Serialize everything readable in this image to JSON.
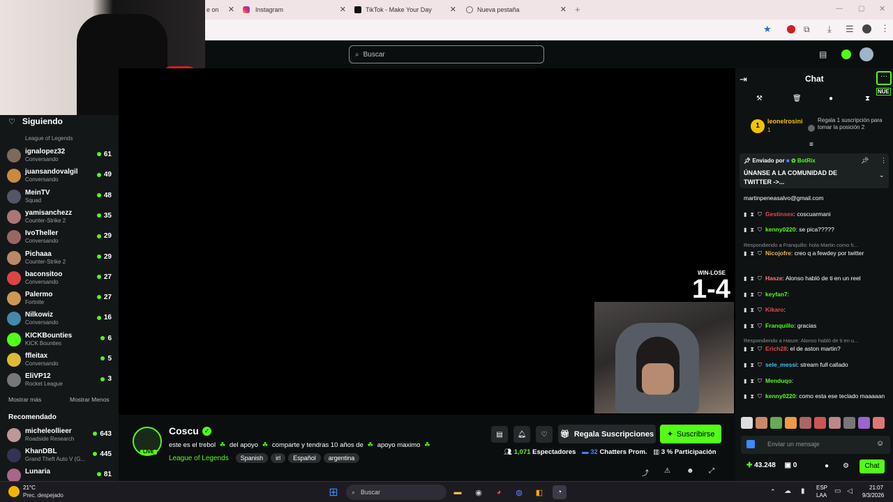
{
  "browser": {
    "tabs": [
      {
        "label": "e on"
      },
      {
        "label": "Instagram"
      },
      {
        "label": "TikTok - Make Your Day"
      },
      {
        "label": "Nueva pestaña"
      }
    ]
  },
  "header": {
    "search_placeholder": "Buscar"
  },
  "sidebar": {
    "following_title": "Siguiendo",
    "top_category": "League of Legends",
    "channels": [
      {
        "name": "ignalopez32",
        "category": "Conversando",
        "viewers": "61",
        "color": "#7d6a5a"
      },
      {
        "name": "juansandovalgil",
        "category": "Conversando",
        "viewers": "49",
        "color": "#c98a40"
      },
      {
        "name": "MeinTV",
        "category": "Squad",
        "viewers": "48",
        "color": "#556"
      },
      {
        "name": "yamisanchezz",
        "category": "Counter-Strike 2",
        "viewers": "35",
        "color": "#a77"
      },
      {
        "name": "IvoTheller",
        "category": "Conversando",
        "viewers": "29",
        "color": "#966"
      },
      {
        "name": "Pichaaa",
        "category": "Counter-Strike 2",
        "viewers": "29",
        "color": "#b86"
      },
      {
        "name": "baconsitoo",
        "category": "Conversando",
        "viewers": "27",
        "color": "#d44"
      },
      {
        "name": "Palermo",
        "category": "Fortnite",
        "viewers": "27",
        "color": "#c95"
      },
      {
        "name": "Nilkowiz",
        "category": "Conversando",
        "viewers": "16",
        "color": "#48a"
      },
      {
        "name": "KICKBounties",
        "category": "KICK Bounties",
        "viewers": "6",
        "color": "#53fc18"
      },
      {
        "name": "ffleitax",
        "category": "Conversando",
        "viewers": "5",
        "color": "#db3"
      },
      {
        "name": "EliVP12",
        "category": "Rocket League",
        "viewers": "3",
        "color": "#777"
      }
    ],
    "show_more": "Mostrar más",
    "show_less": "Mostrar Menos",
    "recommended_title": "Recomendado",
    "recommended": [
      {
        "name": "micheleollieer",
        "category": "Roadside Research",
        "viewers": "643",
        "color": "#b99"
      },
      {
        "name": "KhanDBL",
        "category": "Grand Theft Auto V (G...",
        "viewers": "445",
        "color": "#335"
      },
      {
        "name": "Lunaria",
        "category": "",
        "viewers": "81",
        "color": "#a68"
      }
    ]
  },
  "overlay": {
    "label": "WIN-LOSE",
    "score": "1-4"
  },
  "stream": {
    "streamer": "Coscu",
    "live_badge": "LIVE",
    "title_parts": [
      "este es el trebol",
      "del apoyo",
      "comparte y tendras 10 años de",
      "apoyo maximo"
    ],
    "category": "League of Legends",
    "tags": [
      "Spanish",
      "irl",
      "Español",
      "argentina"
    ],
    "gift_button": "Regala Suscripciones",
    "subscribe_button": "Suscribirse",
    "viewers": "1,071",
    "viewers_label": "Espectadores",
    "chatters": "32",
    "chatters_label": "Chatters Prom.",
    "participation": "3",
    "participation_label": "% Participación"
  },
  "chat": {
    "title": "Chat",
    "new_badge": "NUE",
    "top_gifter": {
      "rank": "1",
      "name": "leonelrosini",
      "count": "1"
    },
    "gift_prompt": "Regala 1 suscripción para tomar la posición 2",
    "pinned": {
      "sent_by": "Enviado por",
      "bot": "BotRix",
      "text": "ÚNANSE A LA COMUNIDAD DE TWITTER ->..."
    },
    "email_line": "martinpeneasalvo@gmail.com",
    "messages": [
      {
        "user": "Gestinsex",
        "text": ": coscuarmani",
        "color": "#e5484d"
      },
      {
        "user": "kenny0220",
        "text": ": se pica?????",
        "color": "#53fc18"
      },
      {
        "reply": "Respondiendo a Franquillo: hola Martin como h..."
      },
      {
        "user": "Nicojofre",
        "text": ": creo q a fewdey por twitter",
        "color": "#e8b84a"
      },
      {
        "user": "Hasze",
        "text": ": Alonso habló de ti en un reel",
        "color": "#ff7a7a"
      },
      {
        "user": "keyfan7",
        "text": ":",
        "color": "#53fc18"
      },
      {
        "user": "Kikaro",
        "text": ":",
        "color": "#e5484d"
      },
      {
        "user": "Franquillo",
        "text": ": gracias",
        "color": "#53fc18"
      },
      {
        "reply": "Respondiendo a Hasze: Alonso habló de ti en u..."
      },
      {
        "user": "Erich28",
        "text": ": el de aston martin?",
        "color": "#e5484d"
      },
      {
        "user": "sele_messi",
        "text": ": stream full callado",
        "color": "#3cc4ff"
      },
      {
        "user": "Menduqo",
        "text": ":",
        "color": "#53fc18"
      },
      {
        "user": "kenny0220",
        "text": ": como esta ese teclado maaaaan",
        "color": "#53fc18"
      }
    ],
    "input_placeholder": "Enviar un mensaje",
    "points": "43.248",
    "zero": "0",
    "send_button": "Chat"
  },
  "taskbar": {
    "weather_temp": "21°C",
    "weather_desc": "Prec. despejado",
    "search": "Buscar",
    "lang": "ESP",
    "lang2": "LAA",
    "time": "21:07",
    "date": "9/3/2026"
  }
}
